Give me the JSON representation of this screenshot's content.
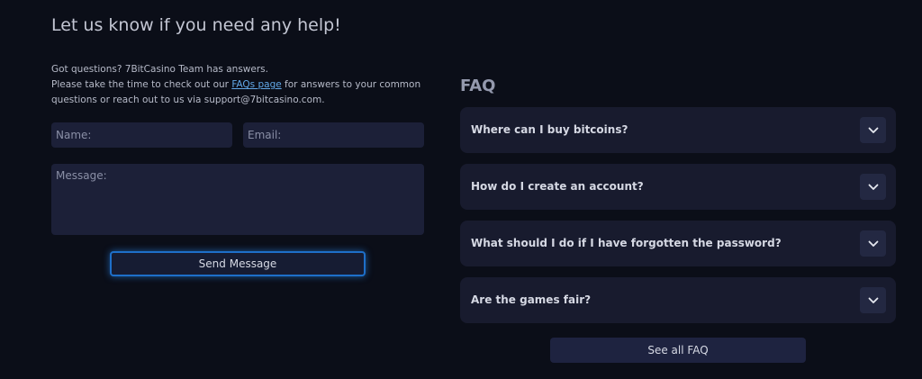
{
  "contact": {
    "title": "Let us know if you need any help!",
    "line1": "Got questions? 7BitCasino Team has answers.",
    "line2_before": "Please take the time to check out our ",
    "faq_link": "FAQs page",
    "line2_after": " for answers to your common questions or reach out to us via support@7bitcasino.com.",
    "name_placeholder": "Name:",
    "email_placeholder": "Email:",
    "message_placeholder": "Message:",
    "send_label": "Send Message"
  },
  "faq": {
    "heading": "FAQ",
    "items": [
      {
        "question": "Where can I buy bitcoins?",
        "icon": "chevron-down-icon"
      },
      {
        "question": "How do I create an account?",
        "icon": "chevron-down-icon"
      },
      {
        "question": "What should I do if I have forgotten the password?",
        "icon": "chevron-down-icon"
      },
      {
        "question": "Are the games fair?",
        "icon": "chevron-down-icon"
      }
    ],
    "see_all_label": "See all FAQ"
  },
  "colors": {
    "background": "#0b0e18",
    "field": "#1c2038",
    "accent": "#1e6fc9",
    "link": "#62a8e8",
    "faq_card": "#181b2e"
  }
}
